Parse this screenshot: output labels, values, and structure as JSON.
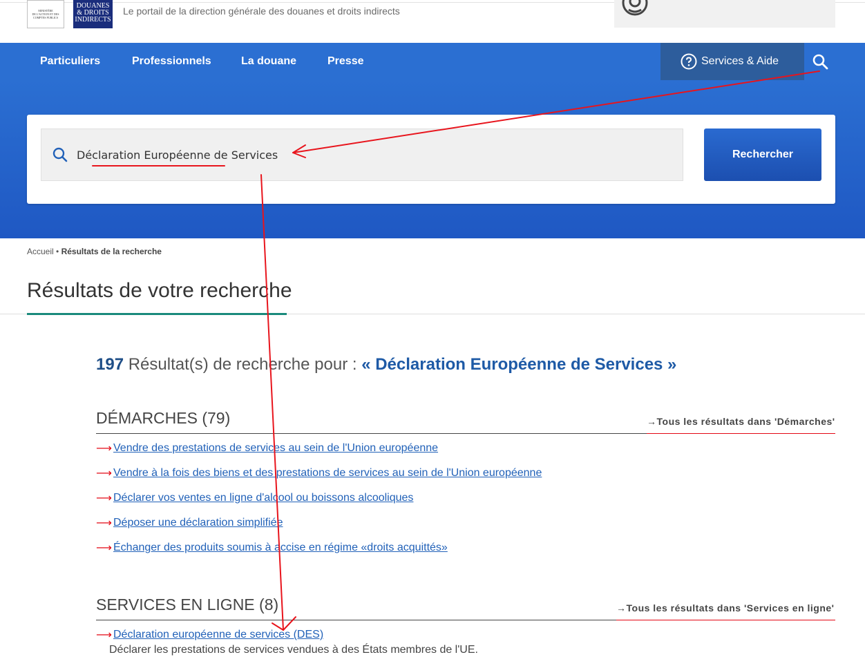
{
  "header": {
    "tagline": "Le portail de la direction générale des douanes et droits indirects",
    "logo_ministere": [
      "MINISTÈRE",
      "DE L'ACTION ET DES",
      "COMPTES PUBLICS"
    ],
    "logo_douane": [
      "DOUANES",
      "& DROITS",
      "INDIRECTS"
    ]
  },
  "nav": {
    "items": [
      "Particuliers",
      "Professionnels",
      "La douane",
      "Presse"
    ],
    "services_label": "Services & Aide"
  },
  "search": {
    "value": "Déclaration Européenne de Services",
    "button_label": "Rechercher"
  },
  "breadcrumb": {
    "home": "Accueil",
    "separator": " • ",
    "current": "Résultats de la recherche"
  },
  "page_title": "Résultats de votre recherche",
  "summary": {
    "count": "197",
    "text": " Résultat(s) de recherche pour : ",
    "query": "« Déclaration Européenne de Services »"
  },
  "sections": [
    {
      "title": "DÉMARCHES (79)",
      "all_link": "Tous les résultats dans 'Démarches'",
      "items": [
        "Vendre des prestations de services au sein de l'Union européenne",
        "Vendre à la fois des biens et des prestations de services au sein de l'Union européenne",
        "Déclarer vos ventes en ligne d'alcool ou boissons alcooliques",
        "Déposer une déclaration simplifiée",
        "Échanger des produits soumis à accise en régime «droits acquittés»"
      ]
    },
    {
      "title": "SERVICES EN LIGNE (8)",
      "all_link": "Tous les résultats dans 'Services en ligne'",
      "items": [
        "Déclaration européenne de services (DES)"
      ],
      "description": "Déclarer les prestations de services vendues à des États membres de l'UE."
    }
  ],
  "icons": {
    "arrow_right": "→",
    "result_arrow": "⟶"
  },
  "colors": {
    "nav_blue": "#2b6fd2",
    "services_bg": "#2d5d9c",
    "link_blue": "#2161b8",
    "accent_red": "#e30613",
    "title_teal": "#1a8a7c"
  }
}
